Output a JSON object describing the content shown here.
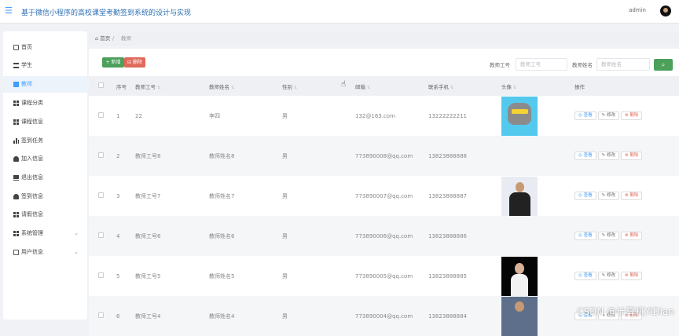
{
  "header": {
    "title": "基于微信小程序的高校课堂考勤签到系统的设计与实现",
    "user": "admin"
  },
  "sidebar": {
    "items": [
      {
        "label": "首页",
        "icon": "home-icon"
      },
      {
        "label": "学生",
        "icon": "list-icon"
      },
      {
        "label": "教师",
        "icon": "document-icon",
        "active": true
      },
      {
        "label": "课程分类",
        "icon": "grid-icon"
      },
      {
        "label": "课程信息",
        "icon": "grid-icon"
      },
      {
        "label": "签到任务",
        "icon": "bar-chart-icon"
      },
      {
        "label": "加入信息",
        "icon": "add-user-icon"
      },
      {
        "label": "退出信息",
        "icon": "monitor-icon"
      },
      {
        "label": "签到信息",
        "icon": "person-icon"
      },
      {
        "label": "请假信息",
        "icon": "grid-icon"
      },
      {
        "label": "系统管理",
        "icon": "grid-icon",
        "expandable": true
      },
      {
        "label": "用户信息",
        "icon": "card-icon",
        "expandable": true
      }
    ]
  },
  "breadcrumb": {
    "home": "首页",
    "current": "教师"
  },
  "toolbar": {
    "add_label": "+ 新增",
    "delete_label": "删除"
  },
  "search": {
    "id_label": "教师工号",
    "id_placeholder": "教师工号",
    "name_label": "教师姓名",
    "name_placeholder": "教师姓名"
  },
  "table": {
    "columns": [
      "序号",
      "教师工号",
      "教师姓名",
      "性别",
      "邮箱",
      "联系手机",
      "头像",
      "操作"
    ],
    "rows": [
      {
        "index": "1",
        "id": "22",
        "name": "李四",
        "gender": "男",
        "email": "132@163.com",
        "phone": "13222222211",
        "avatar": "cat"
      },
      {
        "index": "2",
        "id": "教师工号8",
        "name": "教师姓名8",
        "gender": "男",
        "email": "773890008@qq.com",
        "phone": "13823888888",
        "avatar": ""
      },
      {
        "index": "3",
        "id": "教师工号7",
        "name": "教师姓名7",
        "gender": "男",
        "email": "773890007@qq.com",
        "phone": "13823888887",
        "avatar": "man"
      },
      {
        "index": "4",
        "id": "教师工号6",
        "name": "教师姓名6",
        "gender": "男",
        "email": "773890006@qq.com",
        "phone": "13823888886",
        "avatar": ""
      },
      {
        "index": "5",
        "id": "教师工号5",
        "name": "教师姓名5",
        "gender": "男",
        "email": "773890005@qq.com",
        "phone": "13823888885",
        "avatar": "woman"
      },
      {
        "index": "6",
        "id": "教师工号4",
        "name": "教师姓名4",
        "gender": "男",
        "email": "773890004@qq.com",
        "phone": "13823888884",
        "avatar": "man2"
      }
    ],
    "actions": {
      "view": "查看",
      "edit": "修改",
      "delete": "删除"
    }
  },
  "watermark": "CSDN @计算机YiDian"
}
